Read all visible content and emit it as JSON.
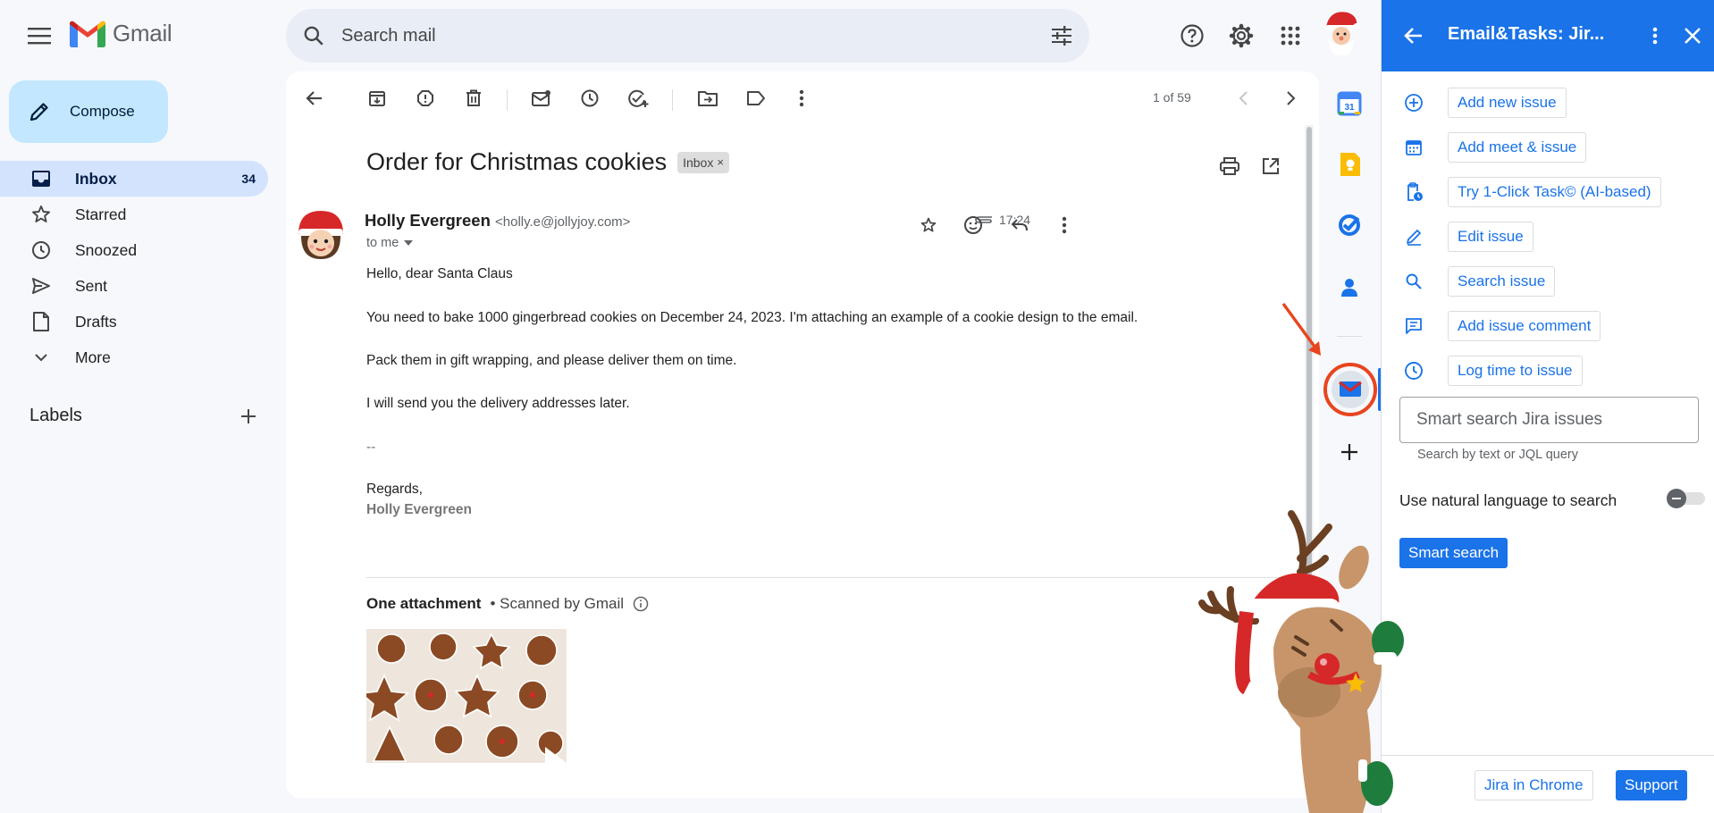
{
  "app": {
    "name": "Gmail"
  },
  "search": {
    "placeholder": "Search mail"
  },
  "nav": {
    "compose_label": "Compose",
    "items": [
      {
        "label": "Inbox",
        "count": "34",
        "icon": "inbox-icon",
        "active": true
      },
      {
        "label": "Starred",
        "icon": "star-icon"
      },
      {
        "label": "Snoozed",
        "icon": "clock-icon"
      },
      {
        "label": "Sent",
        "icon": "send-icon"
      },
      {
        "label": "Drafts",
        "icon": "draft-icon"
      },
      {
        "label": "More",
        "icon": "chevron-down-icon"
      }
    ],
    "labels_title": "Labels"
  },
  "toolbar": {
    "pager": "1 of 59"
  },
  "email": {
    "subject": "Order for Christmas cookies",
    "label_chip": "Inbox",
    "sender_name": "Holly Evergreen",
    "sender_email": "<holly.e@jollyjoy.com>",
    "to": "to me",
    "time": "17:24",
    "body": [
      "Hello, dear Santa Claus",
      "You need to bake 1000 gingerbread cookies on December 24, 2023. I'm attaching an example of a cookie design to the email.",
      "Pack them in gift wrapping, and please deliver them on time.",
      "I will send you the delivery addresses later.",
      "--",
      "Regards,"
    ],
    "signature_name": "Holly Evergreen",
    "attachment_title": "One attachment",
    "attachment_scan": "• Scanned by Gmail"
  },
  "panel": {
    "title": "Email&Tasks: Jir...",
    "actions": [
      {
        "label": "Add new issue",
        "icon": "plus-circle-icon"
      },
      {
        "label": "Add meet & issue",
        "icon": "calendar-icon"
      },
      {
        "label": "Try 1-Click Task© (AI-based)",
        "icon": "clipboard-clock-icon"
      },
      {
        "label": "Edit issue",
        "icon": "pencil-icon"
      },
      {
        "label": "Search issue",
        "icon": "search-icon"
      },
      {
        "label": "Add issue comment",
        "icon": "comment-icon"
      },
      {
        "label": "Log time to issue",
        "icon": "clock-icon"
      }
    ],
    "smart_search_placeholder": "Smart search Jira issues",
    "smart_search_hint": "Search by text or JQL query",
    "natural_language_label": "Use natural language to search",
    "smart_search_button": "Smart search",
    "footer_jira_chrome": "Jira in Chrome",
    "footer_support": "Support"
  },
  "colors": {
    "accent": "#1a73e8",
    "compose_bg": "#c2e7ff",
    "active_nav": "#d3e3fd",
    "highlight_ring": "#e8451e"
  }
}
